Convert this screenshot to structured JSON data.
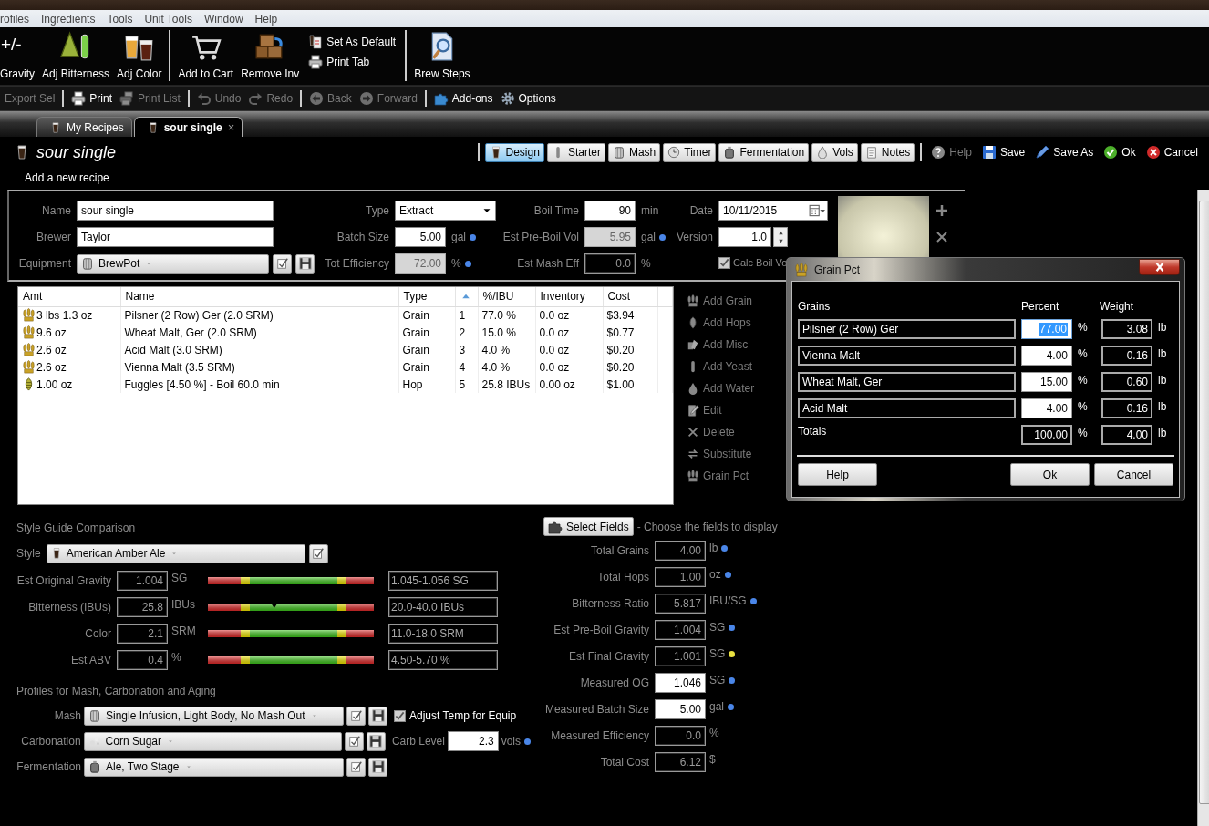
{
  "menu": [
    "rofiles",
    "Ingredients",
    "Tools",
    "Unit Tools",
    "Window",
    "Help"
  ],
  "ribbon": [
    {
      "kind": "large",
      "icon_text": "+/-",
      "label": "Gravity"
    },
    {
      "kind": "large",
      "label": "Adj Bitterness"
    },
    {
      "kind": "large",
      "label": "Adj Color"
    },
    {
      "kind": "separator"
    },
    {
      "kind": "large",
      "label": "Add to Cart"
    },
    {
      "kind": "large",
      "label": "Remove Inv"
    },
    {
      "kind": "small",
      "items": [
        "Set As Default",
        "Print Tab"
      ]
    },
    {
      "kind": "separator"
    },
    {
      "kind": "large",
      "label": "Brew Steps"
    }
  ],
  "quickbar": [
    {
      "kind": "button",
      "label": "Export Sel",
      "disabled": true
    },
    {
      "kind": "separator"
    },
    {
      "kind": "button",
      "label": "Print",
      "disabled": false
    },
    {
      "kind": "button",
      "label": "Print List",
      "disabled": true
    },
    {
      "kind": "separator"
    },
    {
      "kind": "button",
      "label": "Undo",
      "disabled": true
    },
    {
      "kind": "button",
      "label": "Redo",
      "disabled": true
    },
    {
      "kind": "separator"
    },
    {
      "kind": "button",
      "label": "Back",
      "disabled": true
    },
    {
      "kind": "button",
      "label": "Forward",
      "disabled": true
    },
    {
      "kind": "separator"
    },
    {
      "kind": "button",
      "label": "Add-ons",
      "disabled": false
    },
    {
      "kind": "button",
      "label": "Options",
      "disabled": false
    }
  ],
  "tabs": [
    {
      "label": "My Recipes",
      "selected": false
    },
    {
      "label": "sour single",
      "selected": true,
      "close": "×"
    }
  ],
  "recipe": {
    "title": "sour single",
    "subtitle": "Add a new recipe"
  },
  "views": [
    {
      "label": "Design",
      "selected": true
    },
    {
      "label": "Starter",
      "selected": false
    },
    {
      "label": "Mash",
      "selected": false
    },
    {
      "label": "Timer",
      "selected": false
    },
    {
      "label": "Fermentation",
      "selected": false
    },
    {
      "label": "Vols",
      "selected": false
    },
    {
      "label": "Notes",
      "selected": false
    }
  ],
  "actions": [
    {
      "label": "Help",
      "disabled": true
    },
    {
      "label": "Save",
      "disabled": false
    },
    {
      "label": "Save As",
      "disabled": false
    },
    {
      "label": "Ok",
      "disabled": false
    },
    {
      "label": "Cancel",
      "disabled": false
    }
  ],
  "form": {
    "name": {
      "label": "Name",
      "kind": "input",
      "value": "sour single"
    },
    "type": {
      "label": "Type",
      "kind": "select",
      "value": "Extract"
    },
    "boil_time": {
      "label": "Boil Time",
      "kind": "input",
      "value": "90",
      "unit": "min"
    },
    "date": {
      "label": "Date",
      "kind": "date",
      "value": "10/11/2015"
    },
    "brewer": {
      "label": "Brewer",
      "kind": "input",
      "value": "Taylor"
    },
    "batch_size": {
      "label": "Batch Size",
      "kind": "input",
      "value": "5.00",
      "unit": "gal",
      "color": "#4a86e8"
    },
    "pre_boil_vol": {
      "label": "Est Pre-Boil Vol",
      "kind": "readonly",
      "value": "5.95",
      "unit": "gal",
      "color": "#4a86e8"
    },
    "version": {
      "label": "Version",
      "kind": "spinner",
      "value": "1.0"
    },
    "equipment": {
      "label": "Equipment",
      "kind": "dropdown",
      "value": "BrewPot"
    },
    "tot_efficiency": {
      "label": "Tot Efficiency",
      "kind": "readonly",
      "value": "72.00",
      "unit": "%",
      "color": "#4a86e8"
    },
    "mash_eff": {
      "label": "Est Mash Eff",
      "kind": "dark",
      "value": "0.0",
      "unit": "%"
    },
    "calc_boil": {
      "label": "Calc Boil Vo",
      "checked": true,
      "disabled": true
    }
  },
  "table": {
    "columns": [
      "Amt",
      "Name",
      "Type",
      "%/IBU",
      "Inventory",
      "Cost"
    ],
    "rows": [
      {
        "kind": "grain",
        "amount": "3 lbs 1.3 oz",
        "name": "Pilsner (2 Row) Ger (2.0 SRM)",
        "type": "Grain",
        "order": "1",
        "pct": "77.0 %",
        "inventory": "0.0 oz",
        "cost": "$3.94"
      },
      {
        "kind": "grain",
        "amount": "9.6 oz",
        "name": "Wheat Malt, Ger (2.0 SRM)",
        "type": "Grain",
        "order": "2",
        "pct": "15.0 %",
        "inventory": "0.0 oz",
        "cost": "$0.77"
      },
      {
        "kind": "grain",
        "amount": "2.6 oz",
        "name": "Acid Malt (3.0 SRM)",
        "type": "Grain",
        "order": "3",
        "pct": "4.0 %",
        "inventory": "0.0 oz",
        "cost": "$0.20"
      },
      {
        "kind": "grain",
        "amount": "2.6 oz",
        "name": "Vienna Malt (3.5 SRM)",
        "type": "Grain",
        "order": "4",
        "pct": "4.0 %",
        "inventory": "0.0 oz",
        "cost": "$0.20"
      },
      {
        "kind": "hop",
        "amount": "1.00 oz",
        "name": "Fuggles [4.50 %] - Boil 60.0 min",
        "type": "Hop",
        "order": "5",
        "pct": "25.8 IBUs",
        "inventory": "0.00 oz",
        "cost": "$1.00"
      }
    ]
  },
  "side_buttons": [
    {
      "label": "Add Grain",
      "disabled": true
    },
    {
      "label": "Add Hops",
      "disabled": true
    },
    {
      "label": "Add Misc",
      "disabled": true
    },
    {
      "label": "Add Yeast",
      "disabled": true
    },
    {
      "label": "Add Water",
      "disabled": true
    },
    {
      "label": "Edit",
      "disabled": true
    },
    {
      "label": "Delete",
      "disabled": true
    },
    {
      "label": "Substitute",
      "disabled": true
    },
    {
      "label": "Grain Pct",
      "disabled": true
    }
  ],
  "style_guide": {
    "heading": "Style Guide Comparison",
    "style": {
      "label": "Style",
      "value": "American Amber Ale"
    },
    "gauges": [
      {
        "label": "Est Original Gravity",
        "value": "1.004",
        "unit": "SG",
        "range": "1.045-1.056 SG"
      },
      {
        "label": "Bitterness (IBUs)",
        "value": "25.8",
        "unit": "IBUs",
        "range": "20.0-40.0 IBUs",
        "level": 0.4
      },
      {
        "label": "Color",
        "value": "2.1",
        "unit": "SRM",
        "range": "11.0-18.0 SRM"
      },
      {
        "label": "Est ABV",
        "value": "0.4",
        "unit": "%",
        "range": "4.50-5.70 %"
      }
    ]
  },
  "profiles": {
    "heading": "Profiles for Mash, Carbonation and Aging",
    "rows": [
      {
        "label": "Mash",
        "value": "Single Infusion, Light Body, No Mash Out",
        "extra": {
          "kind": "checkbox",
          "label": "Adjust Temp for Equip",
          "checked": true
        }
      },
      {
        "label": "Carbonation",
        "value": "Corn Sugar",
        "extra": {
          "kind": "field",
          "label": "Carb Level",
          "value": "2.3",
          "unit": "vols",
          "color": "#4a86e8"
        }
      },
      {
        "label": "Fermentation",
        "value": "Ale, Two Stage"
      }
    ]
  },
  "stats": {
    "button": "Select Fields",
    "hint": "- Choose the fields to display",
    "rows": [
      {
        "label": "Total Grains",
        "value": "4.00",
        "unit": "lb",
        "editable": false,
        "color": "#4a86e8"
      },
      {
        "label": "Total Hops",
        "value": "1.00",
        "unit": "oz",
        "editable": false,
        "color": "#4a86e8"
      },
      {
        "label": "Bitterness Ratio",
        "value": "5.817",
        "unit": "IBU/SG",
        "editable": false,
        "color": "#4a86e8"
      },
      {
        "label": "Est Pre-Boil Gravity",
        "value": "1.004",
        "unit": "SG",
        "editable": false,
        "color": "#4a86e8"
      },
      {
        "label": "Est Final Gravity",
        "value": "1.001",
        "unit": "SG",
        "editable": false,
        "color": "#e8e040"
      },
      {
        "label": "Measured OG",
        "value": "1.046",
        "unit": "SG",
        "editable": true,
        "color": "#4a86e8"
      },
      {
        "label": "Measured Batch Size",
        "value": "5.00",
        "unit": "gal",
        "editable": true,
        "color": "#4a86e8"
      },
      {
        "label": "Measured Efficiency",
        "value": "0.0",
        "unit": "%",
        "editable": false
      },
      {
        "label": "Total Cost",
        "value": "6.12",
        "unit": "$",
        "editable": false
      }
    ]
  },
  "dialog": {
    "title": "Grain Pct",
    "headers": [
      "Grains",
      "Percent",
      "Weight"
    ],
    "rows": [
      {
        "grain": "Pilsner (2 Row) Ger",
        "percent": "77.00",
        "percent_unit": "%",
        "weight": "3.08",
        "weight_unit": "lb",
        "selected": true
      },
      {
        "grain": "Vienna Malt",
        "percent": "4.00",
        "percent_unit": "%",
        "weight": "0.16",
        "weight_unit": "lb",
        "selected": false
      },
      {
        "grain": "Wheat Malt, Ger",
        "percent": "15.00",
        "percent_unit": "%",
        "weight": "0.60",
        "weight_unit": "lb",
        "selected": false
      },
      {
        "grain": "Acid Malt",
        "percent": "4.00",
        "percent_unit": "%",
        "weight": "0.16",
        "weight_unit": "lb",
        "selected": false
      }
    ],
    "totals": {
      "label": "Totals",
      "percent": "100.00",
      "percent_unit": "%",
      "weight": "4.00",
      "weight_unit": "lb"
    },
    "buttons": [
      "Help",
      "Ok",
      "Cancel"
    ]
  }
}
